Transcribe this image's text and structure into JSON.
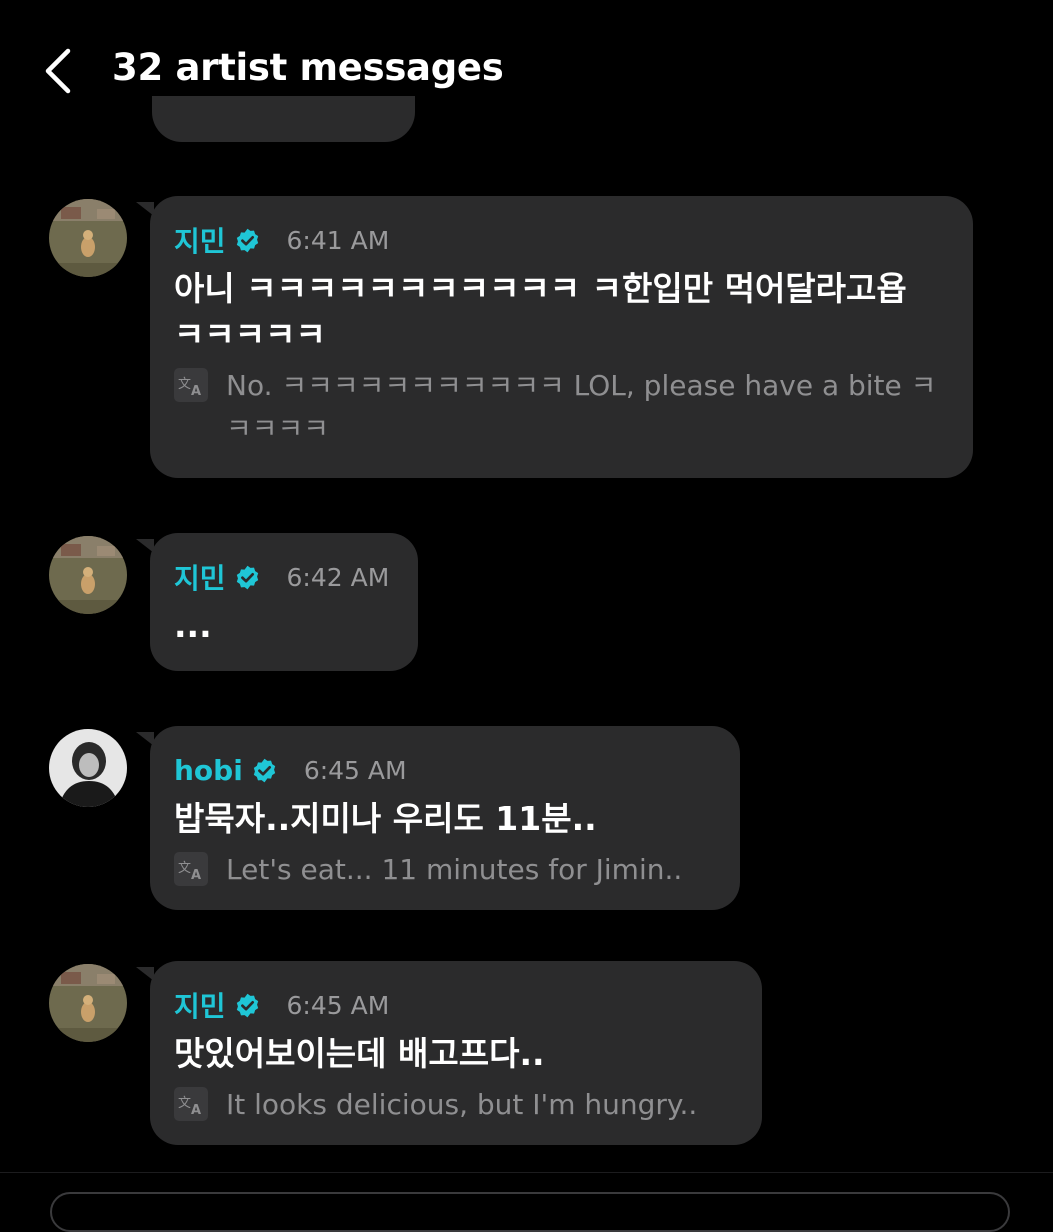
{
  "header": {
    "title": "32 artist messages"
  },
  "colors": {
    "background": "#000000",
    "bubble": "#2b2b2c",
    "accent": "#1fc6d6",
    "time": "#9a9a9c",
    "translation": "#8f8f91"
  },
  "icons": {
    "back": "chevron-left-icon",
    "verified": "verified-badge-icon",
    "translate": "translate-icon"
  },
  "messages": [
    {
      "sender": "지민",
      "time": "6:41 AM",
      "text": "아니 ㅋㅋㅋㅋㅋㅋㅋㅋㅋㅋㅋ ㅋ한입만 먹어달라고욥 ㅋㅋㅋㅋㅋ",
      "translation": "No. ㅋㅋㅋㅋㅋㅋㅋㅋㅋㅋㅋ LOL, please have a bite ㅋㅋㅋㅋㅋ"
    },
    {
      "sender": "지민",
      "time": "6:42 AM",
      "text": "...",
      "translation": ""
    },
    {
      "sender": "hobi",
      "time": "6:45 AM",
      "text": "밥묵자..지미나 우리도 11분..",
      "translation": "Let's eat... 11 minutes for Jimin.."
    },
    {
      "sender": "지민",
      "time": "6:45 AM",
      "text": "맛있어보이는데 배고프다..",
      "translation": "It looks delicious, but I'm hungry.."
    }
  ]
}
